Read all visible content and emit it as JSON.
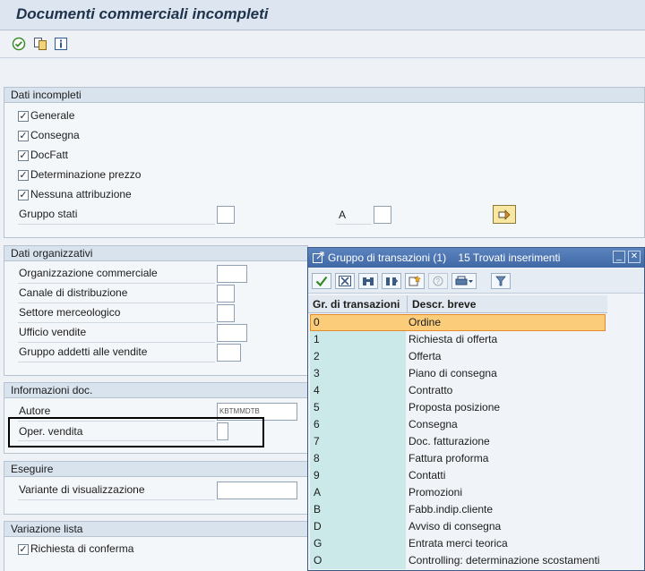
{
  "window": {
    "title": "Documenti commerciali incompleti"
  },
  "toolbar": {
    "execute_icon": "execute-icon",
    "variant_icon": "get-variant-icon",
    "info_icon": "info-icon"
  },
  "sections": {
    "dati_incompleti": {
      "title": "Dati incompleti",
      "checkboxes": [
        {
          "label": "Generale",
          "checked": true
        },
        {
          "label": "Consegna",
          "checked": true
        },
        {
          "label": "DocFatt",
          "checked": true
        },
        {
          "label": "Determinazione prezzo",
          "checked": true
        },
        {
          "label": "Nessuna attribuzione",
          "checked": true
        }
      ],
      "gruppo_stati_label": "Gruppo stati",
      "gruppo_stati_value": "",
      "a_label": "A",
      "a_value": ""
    },
    "dati_organizzativi": {
      "title": "Dati organizzativi",
      "fields": [
        {
          "label": "Organizzazione commerciale",
          "value": ""
        },
        {
          "label": "Canale di distribuzione",
          "value": ""
        },
        {
          "label": "Settore merceologico",
          "value": ""
        },
        {
          "label": "Ufficio vendite",
          "value": ""
        },
        {
          "label": "Gruppo addetti alle vendite",
          "value": ""
        }
      ]
    },
    "informazioni_doc": {
      "title": "Informazioni doc.",
      "autore_label": "Autore",
      "autore_value": "KBTMMDTB",
      "oper_vendita_label": "Oper. vendita",
      "oper_vendita_value": ""
    },
    "eseguire": {
      "title": "Eseguire",
      "variante_label": "Variante di visualizzazione",
      "variante_value": ""
    },
    "variazione_lista": {
      "title": "Variazione lista",
      "richiesta_label": "Richiesta di conferma",
      "richiesta_checked": true
    }
  },
  "popup": {
    "title": "Gruppo di transazioni (1)",
    "found": "15 Trovati inserimenti",
    "buttons": [
      "confirm-icon",
      "cancel-icon",
      "search-icon",
      "search-in-list-icon",
      "new-icon",
      "help-icon",
      "print-icon",
      "filter-icon"
    ],
    "columns": [
      "Gr. di transazioni",
      "Descr. breve"
    ],
    "rows": [
      {
        "code": "0",
        "desc": "Ordine",
        "selected": true
      },
      {
        "code": "1",
        "desc": "Richiesta di offerta"
      },
      {
        "code": "2",
        "desc": "Offerta"
      },
      {
        "code": "3",
        "desc": "Piano di consegna"
      },
      {
        "code": "4",
        "desc": "Contratto"
      },
      {
        "code": "5",
        "desc": "Proposta posizione"
      },
      {
        "code": "6",
        "desc": "Consegna"
      },
      {
        "code": "7",
        "desc": "Doc. fatturazione"
      },
      {
        "code": "8",
        "desc": "Fattura proforma"
      },
      {
        "code": "9",
        "desc": "Contatti"
      },
      {
        "code": "A",
        "desc": "Promozioni"
      },
      {
        "code": "B",
        "desc": "Fabb.indip.cliente"
      },
      {
        "code": "D",
        "desc": "Avviso di consegna"
      },
      {
        "code": "G",
        "desc": "Entrata merci teorica"
      },
      {
        "code": "O",
        "desc": "Controlling: determinazione scostamenti"
      }
    ]
  },
  "colors": {
    "selection": "#fbcd7a",
    "header_blue": "#4a72ad",
    "key_column": "#cce9e9",
    "highlight_frame": "#000000"
  }
}
